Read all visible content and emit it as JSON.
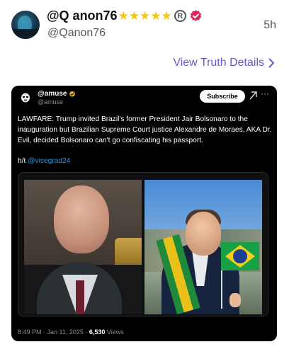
{
  "header": {
    "display_name": "@Q anon76",
    "stars": "★★★★★",
    "reg_mark": "R",
    "handle": "@Qanon76",
    "timestamp": "5h"
  },
  "view_link": {
    "label": "View Truth Details",
    "chevron": ">"
  },
  "embed": {
    "author_name": "@amuse",
    "author_handle": "@amuse",
    "subscribe_label": "Subscribe",
    "more_label": "···",
    "text": "LAWFARE: Trump invited Brazil's former President Jair Bolsonaro to the inauguration but Brazilian Supreme Court justice Alexandre de Moraes, AKA Dr. Evil, decided Bolsonaro can't go confiscating his passport.",
    "hat_tip_prefix": "h/t ",
    "hat_tip_mention": "@visegrad24",
    "time": "8:49 PM · Jan 11, 2025 · ",
    "views_count": "6,530",
    "views_label": " Views"
  },
  "colors": {
    "link": "#6a5acd",
    "star": "#f5c518",
    "verified": "#e0245e",
    "mention": "#1d9bf0"
  },
  "icons": [
    "verified-badge-icon",
    "registered-icon",
    "chevron-right-icon",
    "gold-verified-icon",
    "grok-icon",
    "more-icon"
  ]
}
